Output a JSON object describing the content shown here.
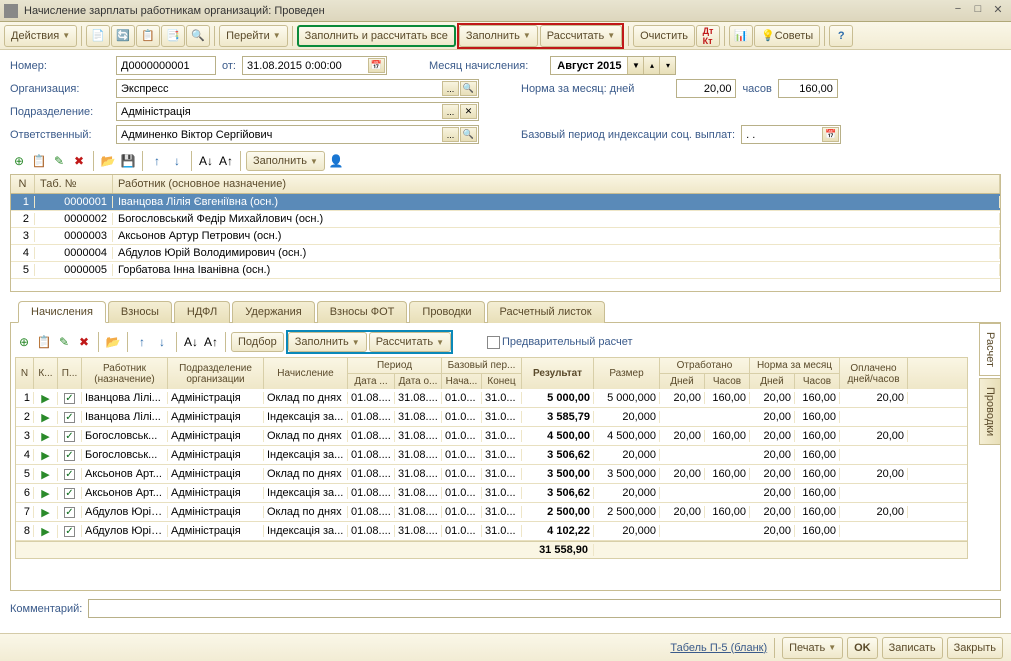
{
  "window": {
    "title": "Начисление зарплаты работникам организаций: Проведен"
  },
  "toolbar": {
    "actions": "Действия",
    "go": "Перейти",
    "fill_calc_all": "Заполнить и рассчитать все",
    "fill": "Заполнить",
    "calc": "Рассчитать",
    "clear": "Очистить",
    "tips": "Советы"
  },
  "form": {
    "number_lbl": "Номер:",
    "number": "Д0000000001",
    "from_lbl": "от:",
    "date": "31.08.2015 0:00:00",
    "month_lbl": "Месяц начисления:",
    "month": "Август 2015",
    "org_lbl": "Организация:",
    "org": "Экспресс",
    "norm_lbl": "Норма за месяц: дней",
    "norm_days": "20,00",
    "hours_lbl": "часов",
    "norm_hours": "160,00",
    "dept_lbl": "Подразделение:",
    "dept": "Адміністрація",
    "resp_lbl": "Ответственный:",
    "resp": "Админенко Віктор Сергійович",
    "base_lbl": "Базовый период индексации соц. выплат:",
    "base_val": ".  .",
    "comment_lbl": "Комментарий:"
  },
  "sub": {
    "fill": "Заполнить",
    "pick": "Подбор",
    "calc": "Рассчитать",
    "preview": "Предварительный расчет"
  },
  "emp": {
    "cols": {
      "n": "N",
      "tab": "Таб. №",
      "worker": "Работник (основное назначение)"
    },
    "rows": [
      {
        "n": "1",
        "tab": "0000001",
        "name": "Іванцова Лілія Євгеніївна (осн.)"
      },
      {
        "n": "2",
        "tab": "0000002",
        "name": "Богословський Федір Михайлович (осн.)"
      },
      {
        "n": "3",
        "tab": "0000003",
        "name": "Аксьонов Артур Петрович (осн.)"
      },
      {
        "n": "4",
        "tab": "0000004",
        "name": "Абдулов Юрій Володимирович (осн.)"
      },
      {
        "n": "5",
        "tab": "0000005",
        "name": "Горбатова Інна Іванівна (осн.)"
      }
    ]
  },
  "tabs": [
    "Начисления",
    "Взносы",
    "НДФЛ",
    "Удержания",
    "Взносы ФОТ",
    "Проводки",
    "Расчетный листок"
  ],
  "sidetabs": [
    "Расчет",
    "Проводки"
  ],
  "calc": {
    "head": {
      "n": "N",
      "k": "К...",
      "p": "П...",
      "worker": "Работник (назначение)",
      "deptorg": "Подразделение организации",
      "charge": "Начисление",
      "period": "Период",
      "d_from": "Дата ...",
      "d_to": "Дата о...",
      "baseper": "Базовый пер...",
      "b_from": "Нача...",
      "b_to": "Конец",
      "result": "Результат",
      "size": "Размер",
      "worked": "Отработано",
      "norm": "Норма за месяц",
      "days": "Дней",
      "hours": "Часов",
      "paid": "Оплачено дней/часов"
    },
    "rows": [
      {
        "n": "1",
        "w": "Іванцова Лілі...",
        "d": "Адміністрація",
        "c": "Оклад по днях",
        "df": "01.08....",
        "dt": "31.08....",
        "bf": "01.0...",
        "bt": "31.0...",
        "res": "5 000,00",
        "sz": "5 000,000",
        "wd": "20,00",
        "wh": "160,00",
        "nd": "20,00",
        "nh": "160,00",
        "pd": "20,00"
      },
      {
        "n": "2",
        "w": "Іванцова Лілі...",
        "d": "Адміністрація",
        "c": "Індексація за...",
        "df": "01.08....",
        "dt": "31.08....",
        "bf": "01.0...",
        "bt": "31.0...",
        "res": "3 585,79",
        "sz": "20,000",
        "wd": "",
        "wh": "",
        "nd": "20,00",
        "nh": "160,00",
        "pd": ""
      },
      {
        "n": "3",
        "w": "Богословськ...",
        "d": "Адміністрація",
        "c": "Оклад по днях",
        "df": "01.08....",
        "dt": "31.08....",
        "bf": "01.0...",
        "bt": "31.0...",
        "res": "4 500,00",
        "sz": "4 500,000",
        "wd": "20,00",
        "wh": "160,00",
        "nd": "20,00",
        "nh": "160,00",
        "pd": "20,00"
      },
      {
        "n": "4",
        "w": "Богословськ...",
        "d": "Адміністрація",
        "c": "Індексація за...",
        "df": "01.08....",
        "dt": "31.08....",
        "bf": "01.0...",
        "bt": "31.0...",
        "res": "3 506,62",
        "sz": "20,000",
        "wd": "",
        "wh": "",
        "nd": "20,00",
        "nh": "160,00",
        "pd": ""
      },
      {
        "n": "5",
        "w": "Аксьонов Арт...",
        "d": "Адміністрація",
        "c": "Оклад по днях",
        "df": "01.08....",
        "dt": "31.08....",
        "bf": "01.0...",
        "bt": "31.0...",
        "res": "3 500,00",
        "sz": "3 500,000",
        "wd": "20,00",
        "wh": "160,00",
        "nd": "20,00",
        "nh": "160,00",
        "pd": "20,00"
      },
      {
        "n": "6",
        "w": "Аксьонов Арт...",
        "d": "Адміністрація",
        "c": "Індексація за...",
        "df": "01.08....",
        "dt": "31.08....",
        "bf": "01.0...",
        "bt": "31.0...",
        "res": "3 506,62",
        "sz": "20,000",
        "wd": "",
        "wh": "",
        "nd": "20,00",
        "nh": "160,00",
        "pd": ""
      },
      {
        "n": "7",
        "w": "Абдулов Юрій...",
        "d": "Адміністрація",
        "c": "Оклад по днях",
        "df": "01.08....",
        "dt": "31.08....",
        "bf": "01.0...",
        "bt": "31.0...",
        "res": "2 500,00",
        "sz": "2 500,000",
        "wd": "20,00",
        "wh": "160,00",
        "nd": "20,00",
        "nh": "160,00",
        "pd": "20,00"
      },
      {
        "n": "8",
        "w": "Абдулов Юрій...",
        "d": "Адміністрація",
        "c": "Індексація за...",
        "df": "01.08....",
        "dt": "31.08....",
        "bf": "01.0...",
        "bt": "31.0...",
        "res": "4 102,22",
        "sz": "20,000",
        "wd": "",
        "wh": "",
        "nd": "20,00",
        "nh": "160,00",
        "pd": ""
      }
    ],
    "total": "31 558,90"
  },
  "footer": {
    "tabel": "Табель П-5 (бланк)",
    "print": "Печать",
    "ok": "OK",
    "save": "Записать",
    "close": "Закрыть"
  }
}
